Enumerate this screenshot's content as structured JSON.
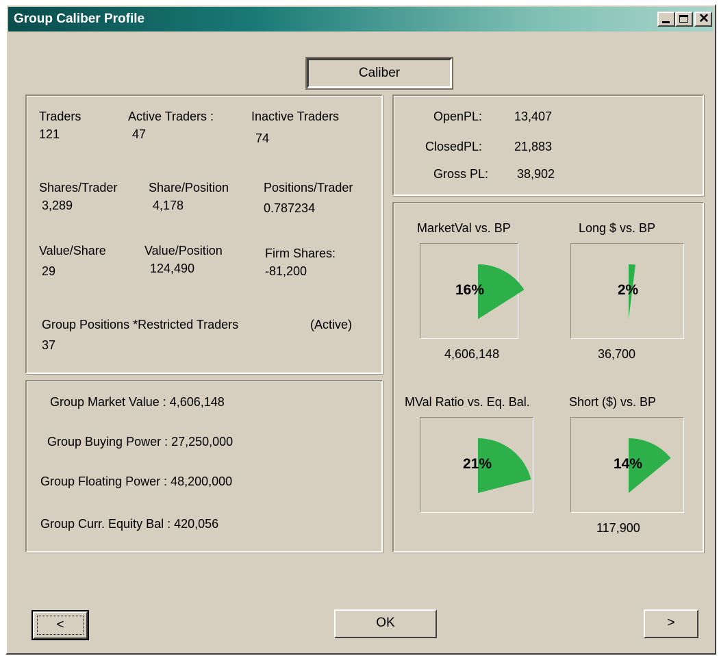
{
  "window": {
    "title": "Group Caliber Profile"
  },
  "caliber_label": "Caliber",
  "traders": {
    "traders_label": "Traders",
    "traders_value": "121",
    "active_label": "Active Traders :",
    "active_value": "47",
    "inactive_label": "Inactive Traders",
    "inactive_value": "74",
    "shares_trader_label": "Shares/Trader",
    "shares_trader_value": "3,289",
    "share_position_label": "Share/Position",
    "share_position_value": "4,178",
    "positions_trader_label": "Positions/Trader",
    "positions_trader_value": "0.787234",
    "value_share_label": "Value/Share",
    "value_share_value": "29",
    "value_position_label": "Value/Position",
    "value_position_value": "124,490",
    "firm_shares_label": "Firm Shares:",
    "firm_shares_value": "-81,200",
    "group_positions_label": "Group Positions *Restricted Traders",
    "active_tag": "(Active)",
    "group_positions_value": "37"
  },
  "group": {
    "market_value": "Group Market Value :  4,606,148",
    "buying_power": "Group Buying Power :  27,250,000",
    "floating_power": "Group Floating Power :  48,200,000",
    "equity_bal": "Group Curr. Equity Bal :  420,056"
  },
  "pl": {
    "open_label": "OpenPL:",
    "open_value": "13,407",
    "closed_label": "ClosedPL:",
    "closed_value": "21,883",
    "gross_label": "Gross PL:",
    "gross_value": "38,902"
  },
  "gauges": [
    {
      "title": "MarketVal vs. BP",
      "percent": "16%",
      "fraction": 0.16,
      "value": "4,606,148"
    },
    {
      "title": "Long $ vs. BP",
      "percent": "2%",
      "fraction": 0.02,
      "value": "36,700"
    },
    {
      "title": "MVal Ratio vs. Eq. Bal.",
      "percent": "21%",
      "fraction": 0.21,
      "value": ""
    },
    {
      "title": "Short ($) vs. BP",
      "percent": "14%",
      "fraction": 0.14,
      "value": "117,900"
    }
  ],
  "buttons": {
    "prev": "<",
    "ok": "OK",
    "next": ">"
  },
  "colors": {
    "gauge_fill": "#2db04a",
    "titlebar_start": "#0a4d4d",
    "titlebar_end": "#a9d4c8"
  }
}
